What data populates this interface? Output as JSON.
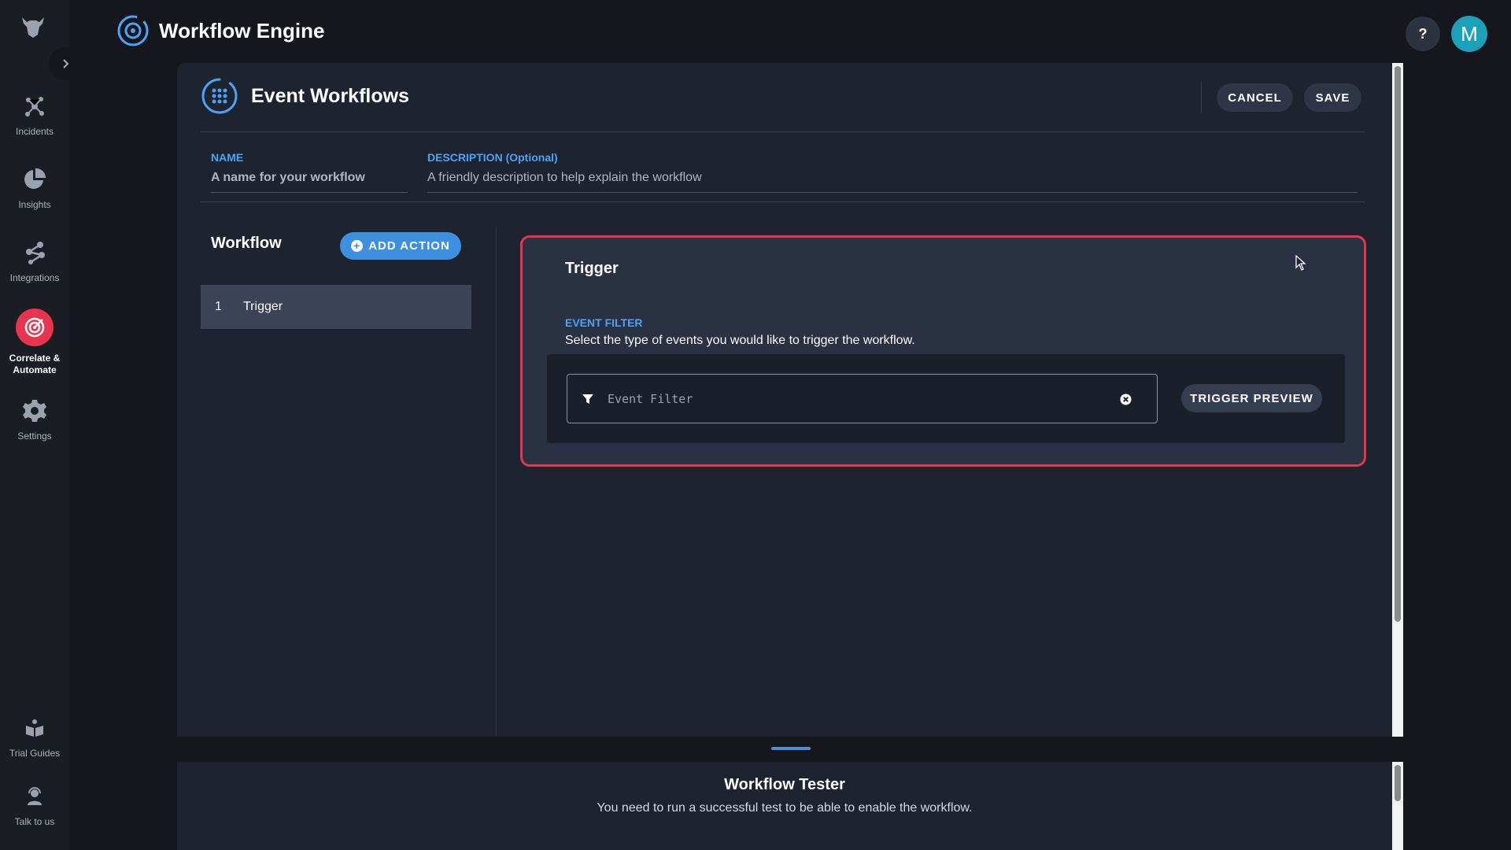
{
  "app": {
    "title": "Workflow Engine",
    "help_label": "?",
    "avatar_initial": "M"
  },
  "sidebar": {
    "items": [
      {
        "label": "Incidents",
        "icon": "incidents-icon"
      },
      {
        "label": "Insights",
        "icon": "pie-chart-icon"
      },
      {
        "label": "Integrations",
        "icon": "integrations-icon"
      },
      {
        "label": "Correlate &\nAutomate",
        "icon": "target-icon",
        "active": true
      },
      {
        "label": "Settings",
        "icon": "gear-icon"
      }
    ],
    "bottom_items": [
      {
        "label": "Trial Guides",
        "icon": "book-icon"
      },
      {
        "label": "Talk to us",
        "icon": "support-agent-icon"
      }
    ]
  },
  "editor": {
    "title": "Event Workflows",
    "cancel_label": "CANCEL",
    "save_label": "SAVE",
    "name_label": "NAME",
    "name_placeholder": "A name for your workflow",
    "description_label": "DESCRIPTION (Optional)",
    "description_placeholder": "A friendly description to help explain the workflow"
  },
  "workflow": {
    "title": "Workflow",
    "add_action_label": "ADD ACTION",
    "steps": [
      {
        "number": "1",
        "label": "Trigger"
      }
    ]
  },
  "trigger": {
    "title": "Trigger",
    "event_filter_label": "EVENT FILTER",
    "event_filter_help": "Select the type of events you would like to trigger the workflow.",
    "event_filter_placeholder": "Event Filter",
    "preview_label": "TRIGGER PREVIEW"
  },
  "tester": {
    "title": "Workflow Tester",
    "message": "You need to run a successful test to be able to enable the workflow."
  },
  "colors": {
    "accent_blue": "#4aa3f5",
    "active_red": "#e8344f",
    "avatar_teal": "#1aa0b8"
  }
}
